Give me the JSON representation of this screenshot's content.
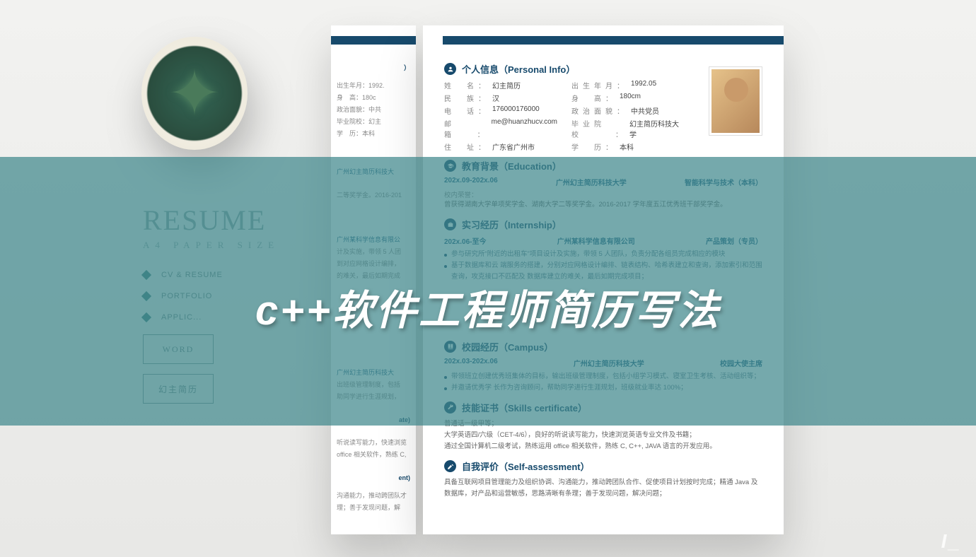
{
  "overlay_title": "c++软件工程师简历写法",
  "left": {
    "heading": "RESUME",
    "subheading": "A4 PAPER SIZE",
    "menu": [
      "CV & RESUME",
      "PORTFOLIO",
      "APPLIC..."
    ],
    "button1": "WORD",
    "button2": "幻主简历"
  },
  "peek": {
    "line_t": "）",
    "l1": "出生年月：1992.",
    "l2": "身　高：180c",
    "l3": "政治面貌：中共",
    "l4": "毕业院校：幻主",
    "l5": "学　历：本科",
    "e1": "广州幻主简历科技大",
    "e2": "二等奖学金。2016-201",
    "i1": "广州某科学信息有限公",
    "i2": "计及实施，带领 5 人团",
    "i3": "到对应网格设计编排，",
    "i4": "的难关，最后如期完成",
    "c1": "广州幻主简历科技大",
    "c2": "出班级管理制度，包括",
    "c3": "助同学进行生涯规划，",
    "s_head": "ate)",
    "s1": "听说读写能力，快速浏览",
    "s2": "office 相关软件，熟练 C,",
    "a_head": "ent)",
    "a1": "沟通能力，推动跨团队才",
    "a2": "理；善于发现问题，解"
  },
  "resume": {
    "sections": {
      "personal": {
        "title": "个人信息（Personal Info）"
      },
      "education": {
        "title": "教育背景（Education）"
      },
      "internship": {
        "title": "实习经历（Internship）"
      },
      "campus": {
        "title": "校园经历（Campus）"
      },
      "skills": {
        "title": "技能证书（Skills certificate）"
      },
      "assessment": {
        "title": "自我评价（Self-assessment）"
      }
    },
    "personal": {
      "name_k": "姓　名：",
      "name_v": "幻主简历",
      "birth_k": "出生年月：",
      "birth_v": "1992.05",
      "ethnic_k": "民　族：",
      "ethnic_v": "汉",
      "height_k": "身　高：",
      "height_v": "180cm",
      "phone_k": "电　话：",
      "phone_v": "176000176000",
      "politics_k": "政治面貌：",
      "politics_v": "中共党员",
      "mail_k": "邮　箱：",
      "mail_v": "me@huanzhucv.com",
      "school_k": "毕业院校：",
      "school_v": "幻主简历科技大学",
      "addr_k": "住　址：",
      "addr_v": "广东省广州市",
      "degree_k": "学　历：",
      "degree_v": "本科"
    },
    "education": {
      "date": "202x.09-202x.06",
      "school": "广州幻主简历科技大学",
      "major": "智能科学与技术（本科）",
      "honor_label": "校内荣誉：",
      "honor": "曾获得湖南大学单项奖学金、湖南大学二等奖学金。2016-2017 学年度五江优秀班干部奖学金。"
    },
    "internship": {
      "e1": {
        "date": "202x.06-至今",
        "company": "广州某科学信息有限公司",
        "role": "产品策划（专员）",
        "b1": "参与研究所“附近的出租车”项目设计及实施，带领 5 人团队，负责分配各组员完成相应的模块",
        "b2": "基于数据库和云 端服务的搭建，分别对应网格设计编排、链表结构、哈希表建立和查询，添加索引和范围查询，攻克接口不匹配及 数据库建立的难关，最后如期完成项目；"
      }
    },
    "campus": {
      "date": "202x.03-202x.06",
      "school": "广州幻主简历科技大学",
      "role": "校园大使主席",
      "b1": "带领班立创建优秀班集体的目标，输出班级管理制度，包括小组学习模式、寝室卫生考核、活动组织等；",
      "b2": "并邀请优秀学 长作为咨询顾问，帮助同学进行生涯规划，班级就业率达 100%；"
    },
    "skills": {
      "l1": "普通话一级甲等；",
      "l2": "大学英语四/六级（CET-4/6），良好的听说读写能力，快速浏览英语专业文件及书籍；",
      "l3": "通过全国计算机二级考试，熟练运用 office 相关软件，熟练 C, C++, JAVA 语言的开发应用。"
    },
    "assessment": {
      "text": "具备互联网项目管理能力及组织协调、沟通能力，推动跨团队合作、促使项目计划按时完成；精通 Java 及数据库，对产品和运营敏感，思路清晰有条理；善于发现问题，解决问题；"
    }
  },
  "watermark": "I_"
}
